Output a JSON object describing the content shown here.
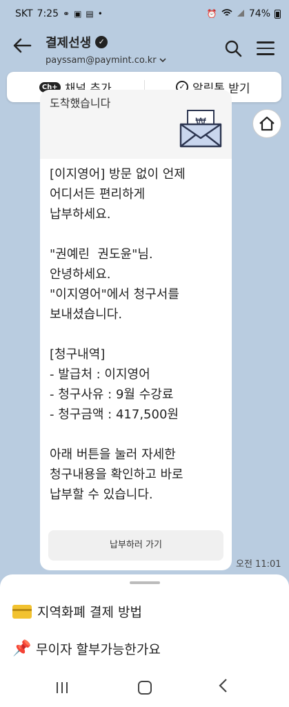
{
  "status": {
    "carrier": "SKT",
    "time": "7:25",
    "battery": "74%"
  },
  "header": {
    "title": "결제선생",
    "subtitle": "payssam@paymint.co.kr"
  },
  "actions": {
    "add_channel": "채널 추가",
    "channel_badge": "Ch+",
    "alimtalk": "알림톡 받기"
  },
  "message": {
    "cut_text": "도착했습니다",
    "body": "[이지영어] 방문 없이 언제\n어디서든 편리하게\n납부하세요.\n\n\"권예린  권도윤\"님.\n안녕하세요.\n\"이지영어\"에서 청구서를\n보내셨습니다.\n\n[청구내역]\n- 발급처 : 이지영어\n- 청구사유 : 9월 수강료\n- 청구금액 : 417,500원\n\n아래 버튼을 눌러 자세한\n청구내용을 확인하고 바로\n납부할 수 있습니다.",
    "button": "납부하러 가기",
    "time": "오전 11:01"
  },
  "sheet": {
    "items": [
      {
        "icon": "credit-card-icon",
        "label": "지역화폐 결제 방법"
      },
      {
        "icon": "pushpin-icon",
        "label": "무이자 할부가능한가요"
      }
    ]
  },
  "colors": {
    "chat_bg": "#b9cce0",
    "bubble": "#ffffff"
  }
}
